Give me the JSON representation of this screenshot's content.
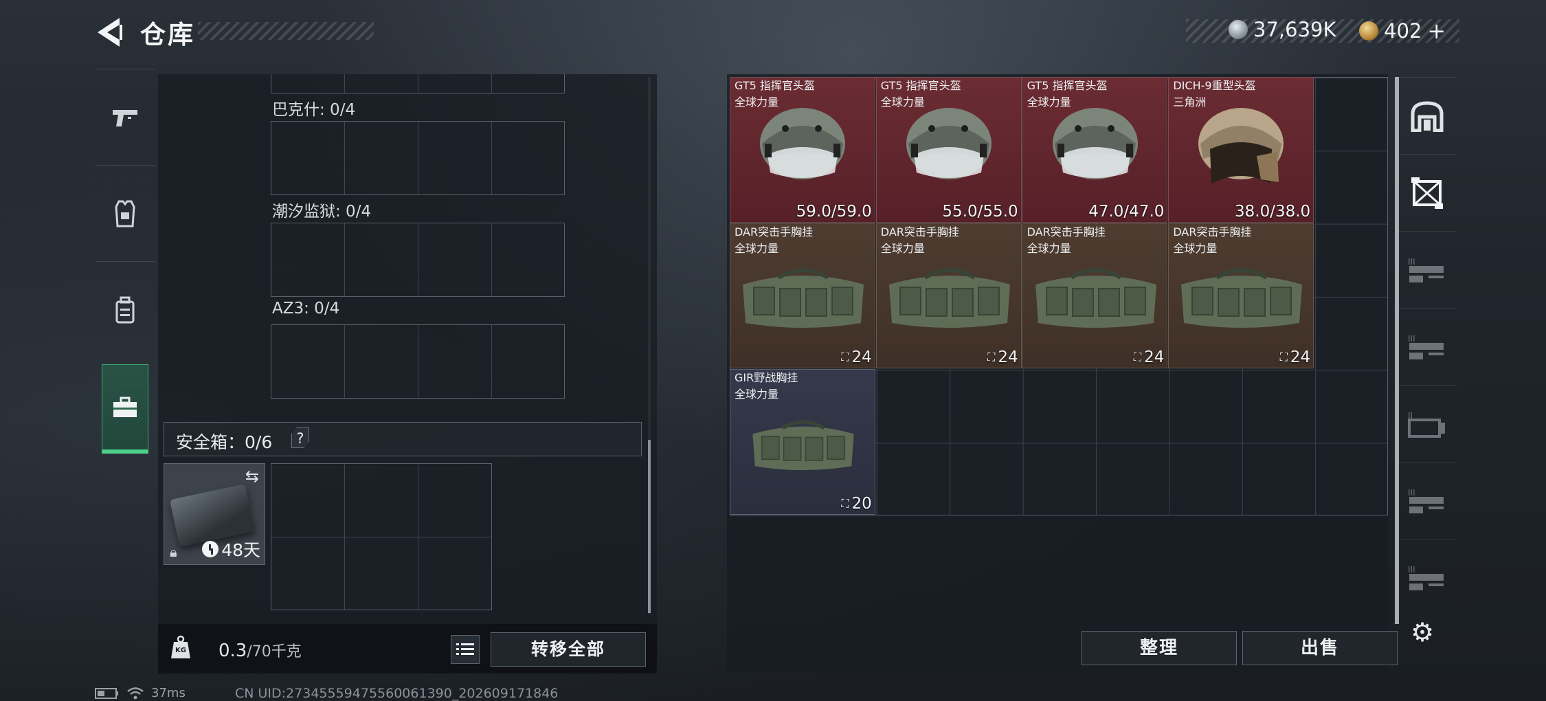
{
  "header": {
    "title": "仓库",
    "currency_silver": "37,639K",
    "currency_gold": "402",
    "currency_add": "+"
  },
  "left_panel": {
    "slots": [
      {
        "label": "巴克什: 0/4"
      },
      {
        "label": "潮汐监狱: 0/4"
      },
      {
        "label": "AZ3: 0/4"
      }
    ],
    "safe_box_label": "安全箱：0/6",
    "safe_box_help": "?",
    "safe_case_days": "48天",
    "weight_current": "0.3",
    "weight_max": "/70千克",
    "weight_icon_text": "KG",
    "transfer_all_label": "转移全部"
  },
  "stash": {
    "items": [
      {
        "name": "GT5 指挥官头盔",
        "sub": "全球力量",
        "value": "59.0/59.0",
        "kind": "helmet"
      },
      {
        "name": "GT5 指挥官头盔",
        "sub": "全球力量",
        "value": "55.0/55.0",
        "kind": "helmet"
      },
      {
        "name": "GT5 指挥官头盔",
        "sub": "全球力量",
        "value": "47.0/47.0",
        "kind": "helmet"
      },
      {
        "name": "DICH-9重型头盔",
        "sub": "三角洲",
        "value": "38.0/38.0",
        "kind": "helmet"
      },
      {
        "name": "DAR突击手胸挂",
        "sub": "全球力量",
        "value": "24",
        "kind": "vest"
      },
      {
        "name": "DAR突击手胸挂",
        "sub": "全球力量",
        "value": "24",
        "kind": "vest"
      },
      {
        "name": "DAR突击手胸挂",
        "sub": "全球力量",
        "value": "24",
        "kind": "vest"
      },
      {
        "name": "DAR突击手胸挂",
        "sub": "全球力量",
        "value": "24",
        "kind": "vest"
      },
      {
        "name": "GIR野战胸挂",
        "sub": "全球力量",
        "value": "20",
        "kind": "vest"
      }
    ],
    "sort_label": "整理",
    "sell_label": "出售"
  },
  "status_bar": {
    "ping": "37ms",
    "uid": "CN UID:27345559475560061390_202609171846"
  },
  "colors": {
    "accent_green": "#4fd08a",
    "red_rarity": "#6b2c33",
    "brown_rarity": "#4e3c30",
    "blue_rarity": "#35394b"
  }
}
